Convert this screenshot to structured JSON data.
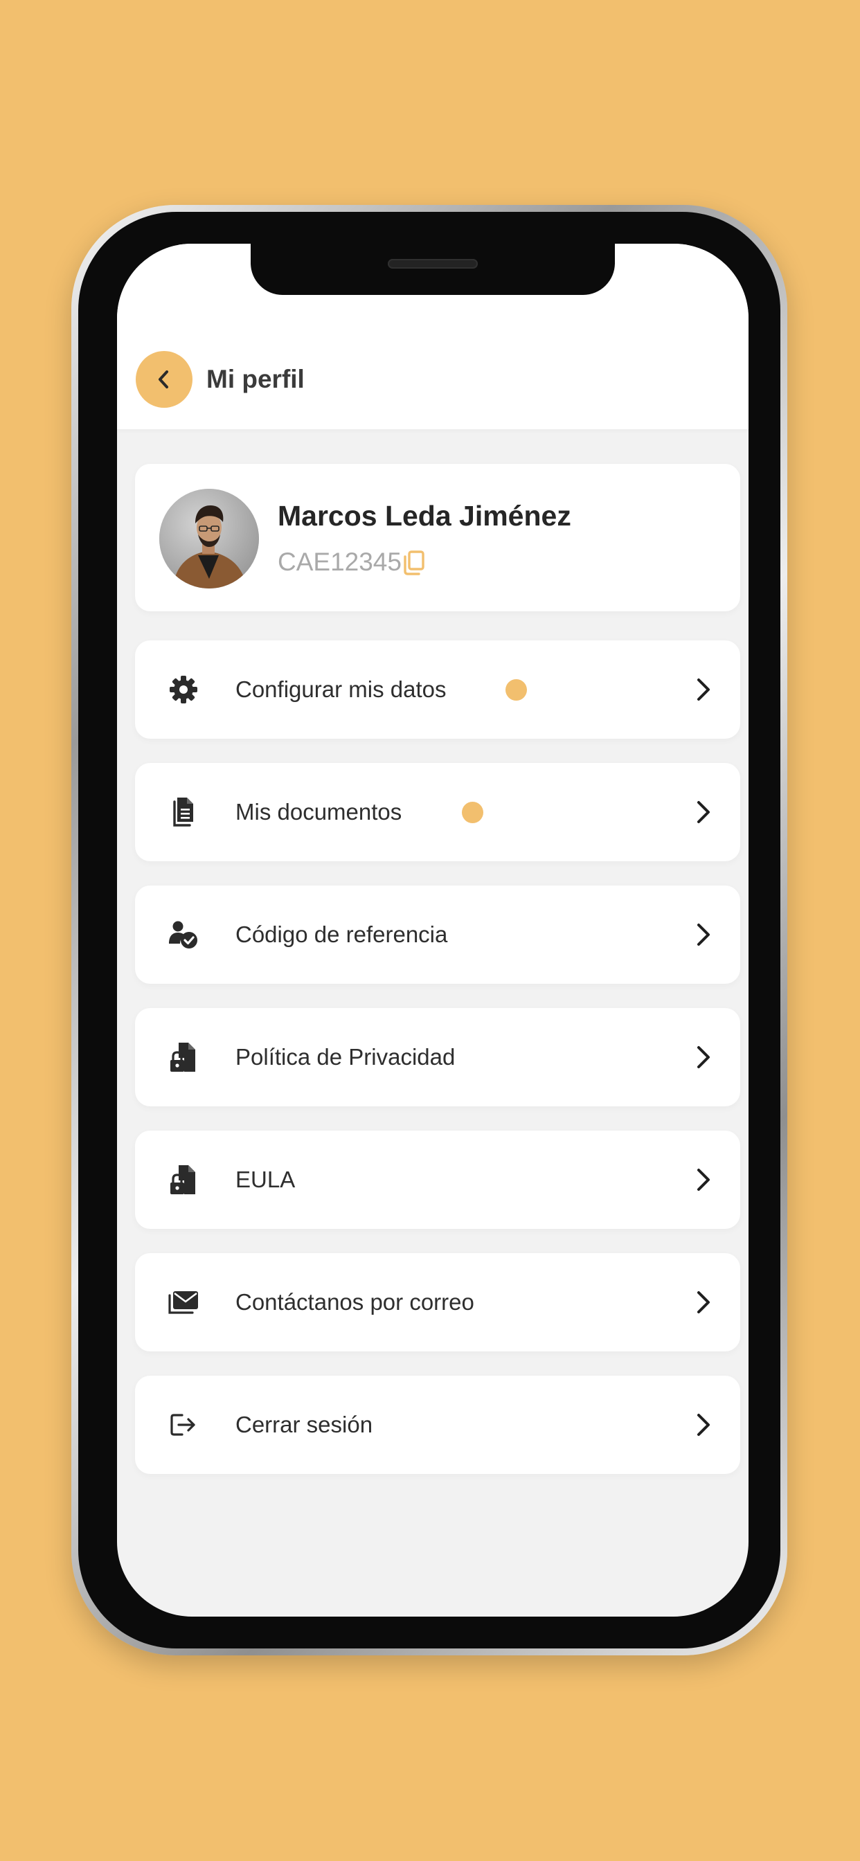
{
  "app": {
    "accent_color": "#F2BF6E",
    "background_color": "#F2F2F2"
  },
  "header": {
    "back_icon": "chevron-left-icon",
    "title": "Mi perfil"
  },
  "profile": {
    "name": "Marcos Leda Jiménez",
    "code": "CAE12345",
    "copy_icon": "copy-icon",
    "avatar_icon": "avatar"
  },
  "menu": {
    "items": [
      {
        "label": "Configurar mis datos",
        "icon": "gear-icon",
        "has_notification": true
      },
      {
        "label": "Mis documentos",
        "icon": "documents-icon",
        "has_notification": true
      },
      {
        "label": "Código de referencia",
        "icon": "referral-user-check-icon",
        "has_notification": false
      },
      {
        "label": "Política de Privacidad",
        "icon": "locked-document-icon",
        "has_notification": false
      },
      {
        "label": "EULA",
        "icon": "locked-document-icon",
        "has_notification": false
      },
      {
        "label": "Contáctanos por correo",
        "icon": "mail-icon",
        "has_notification": false
      },
      {
        "label": "Cerrar sesión",
        "icon": "logout-icon",
        "has_notification": false
      }
    ]
  }
}
